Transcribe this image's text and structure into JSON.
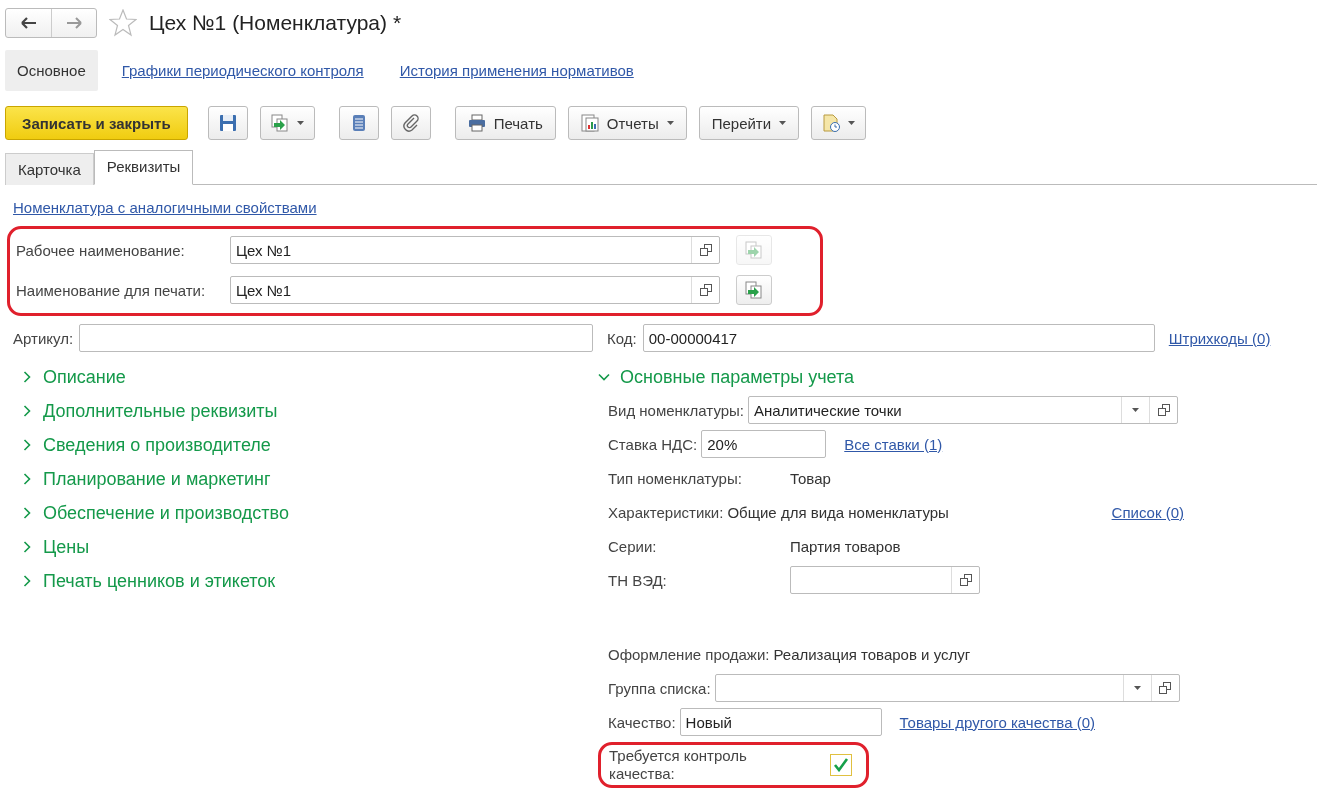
{
  "window": {
    "title": "Цех №1 (Номенклатура) *",
    "favorite": false
  },
  "nav": [
    {
      "label": "Основное",
      "selected": true
    },
    {
      "label": "Графики периодического контроля",
      "selected": false
    },
    {
      "label": "История применения нормативов",
      "selected": false
    }
  ],
  "toolbar": [
    {
      "kind": "primary",
      "label": "Записать и закрыть",
      "dropdown": false
    },
    {
      "kind": "save",
      "dropdown": false
    },
    {
      "kind": "copy",
      "dropdown": true
    },
    {
      "kind": "list",
      "dropdown": false
    },
    {
      "kind": "attach",
      "dropdown": false
    },
    {
      "kind": "print",
      "label": "Печать",
      "dropdown": false
    },
    {
      "kind": "reports",
      "label": "Отчеты",
      "dropdown": true
    },
    {
      "kind": "plain",
      "label": "Перейти",
      "dropdown": true
    },
    {
      "kind": "document",
      "dropdown": true
    }
  ],
  "tabs": [
    {
      "label": "Карточка",
      "selected": false
    },
    {
      "label": "Реквизиты",
      "selected": true
    }
  ],
  "similar_link": "Номенклатура с аналогичными свойствами",
  "names": {
    "highlighted": true,
    "rows": [
      {
        "label": "Рабочее наименование:",
        "value": "Цех №1",
        "copy_enabled": false
      },
      {
        "label": "Наименование для печати:",
        "value": "Цех №1",
        "copy_enabled": true
      }
    ]
  },
  "article": {
    "label": "Артикул:"
  },
  "code": {
    "label": "Код:",
    "value": "00-00000417"
  },
  "barcodes_link": "Штрихкоды (0)",
  "groups": [
    {
      "label": "Описание",
      "expanded": false
    },
    {
      "label": "Дополнительные реквизиты",
      "expanded": false
    },
    {
      "label": "Сведения о производителе",
      "expanded": false
    },
    {
      "label": "Планирование и маркетинг",
      "expanded": false
    },
    {
      "label": "Обеспечение и производство",
      "expanded": false
    },
    {
      "label": "Цены",
      "expanded": false
    },
    {
      "label": "Печать ценников и этикеток",
      "expanded": false
    }
  ],
  "main_params": {
    "title": "Основные параметры учета",
    "expanded": true,
    "rows": [
      {
        "kind": "select",
        "label": "Вид номенклатуры:",
        "value": "Аналитические точки"
      },
      {
        "kind": "input",
        "label": "Ставка НДС:",
        "value": "20%",
        "link": "Все ставки (1)"
      },
      {
        "kind": "text",
        "label": "Тип номенклатуры:",
        "value": "Товар"
      },
      {
        "kind": "text",
        "label": "Характеристики:",
        "value": "Общие для вида номенклатуры",
        "link": "Список (0)"
      },
      {
        "kind": "text",
        "label": "Серии:",
        "value": "Партия товаров"
      },
      {
        "kind": "field",
        "label": "ТН ВЭД:"
      },
      {
        "kind": "text",
        "label": "Оформление продажи:",
        "value": "Реализация товаров и услуг"
      },
      {
        "kind": "select",
        "label": "Группа списка:"
      },
      {
        "kind": "input",
        "label": "Качество:",
        "value": "Новый",
        "link": "Товары другого качества (0)"
      },
      {
        "kind": "checkbox",
        "label": "Требуется контроль качества:",
        "checked": true,
        "highlighted": true
      }
    ]
  }
}
